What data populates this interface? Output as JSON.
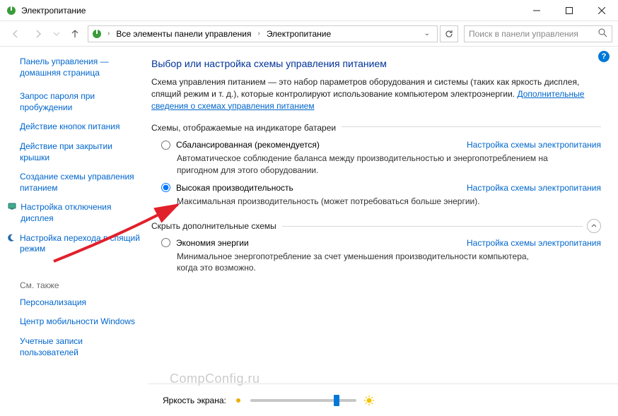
{
  "window": {
    "title": "Электропитание"
  },
  "addressbar": {
    "crumb1": "Все элементы панели управления",
    "crumb2": "Электропитание",
    "search_placeholder": "Поиск в панели управления"
  },
  "sidebar": {
    "home": "Панель управления — домашняя страница",
    "items": [
      "Запрос пароля при пробуждении",
      "Действие кнопок питания",
      "Действие при закрытии крышки",
      "Создание схемы управления питанием",
      "Настройка отключения дисплея",
      "Настройка перехода в спящий режим"
    ],
    "see_also_label": "См. также",
    "see_also": [
      "Персонализация",
      "Центр мобильности Windows",
      "Учетные записи пользователей"
    ]
  },
  "content": {
    "title": "Выбор или настройка схемы управления питанием",
    "desc": "Схема управления питанием — это набор параметров оборудования и системы (таких как яркость дисплея, спящий режим и т. д.), которые контролируют использование компьютером электроэнергии.",
    "desc_link": "Дополнительные сведения о схемах управления питанием",
    "section_battery": "Схемы, отображаемые на индикаторе батареи",
    "section_hide": "Скрыть дополнительные схемы",
    "plan_link": "Настройка схемы электропитания",
    "plans": {
      "balanced": {
        "name": "Сбалансированная (рекомендуется)",
        "desc": "Автоматическое соблюдение баланса между производительностью и энергопотреблением на пригодном для этого оборудовании."
      },
      "high": {
        "name": "Высокая производительность",
        "desc": "Максимальная производительность (может потребоваться больше энергии)."
      },
      "eco": {
        "name": "Экономия энергии",
        "desc": "Минимальное энергопотребление за счет уменьшения производительности компьютера, когда это возможно."
      }
    }
  },
  "footer": {
    "brightness_label": "Яркость экрана:"
  },
  "watermark": "CompConfig.ru"
}
